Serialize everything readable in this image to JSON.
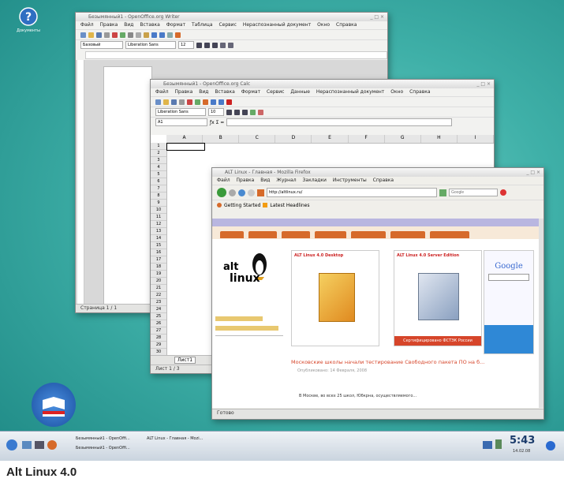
{
  "desktop": {
    "icons": [
      {
        "label": "Документы"
      }
    ]
  },
  "writer": {
    "title": "Безымянный1 - OpenOffice.org Writer",
    "menu": [
      "Файл",
      "Правка",
      "Вид",
      "Вставка",
      "Формат",
      "Таблица",
      "Сервис",
      "Нераспознанный документ",
      "Окно",
      "Справка"
    ],
    "style_value": "Базовый",
    "font_value": "Liberation Sans",
    "size_value": "12",
    "status": "Страница 1 / 1"
  },
  "calc": {
    "title": "Безымянный1 - OpenOffice.org Calc",
    "menu": [
      "Файл",
      "Правка",
      "Вид",
      "Вставка",
      "Формат",
      "Сервис",
      "Данные",
      "Нераспознанный документ",
      "Окно",
      "Справка"
    ],
    "font_value": "Liberation Sans",
    "size_value": "10",
    "cell_ref": "A1",
    "columns": [
      "A",
      "B",
      "C",
      "D",
      "E",
      "F",
      "G",
      "H",
      "I"
    ],
    "rows": [
      "1",
      "2",
      "3",
      "4",
      "5",
      "6",
      "7",
      "8",
      "9",
      "10",
      "11",
      "12",
      "13",
      "14",
      "15",
      "16",
      "17",
      "18",
      "19",
      "20",
      "21",
      "22",
      "23",
      "24",
      "25",
      "26",
      "27",
      "28",
      "29",
      "30",
      "31"
    ],
    "sheet_tab": "Лист1",
    "status": "Лист 1 / 3"
  },
  "firefox": {
    "title": "ALT Linux - Главная - Mozilla Firefox",
    "menu": [
      "Файл",
      "Правка",
      "Вид",
      "Журнал",
      "Закладки",
      "Инструменты",
      "Справка"
    ],
    "url": "http://altlinux.ru/",
    "search_placeholder": "Google",
    "bookmarks": [
      "Getting Started",
      "Latest Headlines"
    ],
    "site": {
      "logo_text_1": "alt",
      "logo_text_2": "linux",
      "products": [
        "ALT Linux 4.0 Desktop",
        "ALT Linux 4.0 Server Edition"
      ],
      "cert_banner": "Сертифицировано ФСТЭК России",
      "headline": "Московские школы начали тестирование Свободного пакета ПО на б...",
      "date": "Опубликовано: 14 Февраля, 2008",
      "body_start": "В Москве, во всех 25 школ, Юбкрна, осуществляемого..."
    },
    "status": "Готово"
  },
  "taskbar": {
    "tasks": [
      "Безымянный1 - OpenOffi...",
      "Безымянный1 - OpenOffi...",
      "ALT Linux - Главная - Mozi..."
    ],
    "clock": "5:43",
    "date": "14.02.08"
  },
  "caption": "Alt Linux 4.0",
  "colors": {
    "desktop": "#3fb0a8",
    "accent": "#d66a2a",
    "taskbar": "#c9d3de"
  }
}
